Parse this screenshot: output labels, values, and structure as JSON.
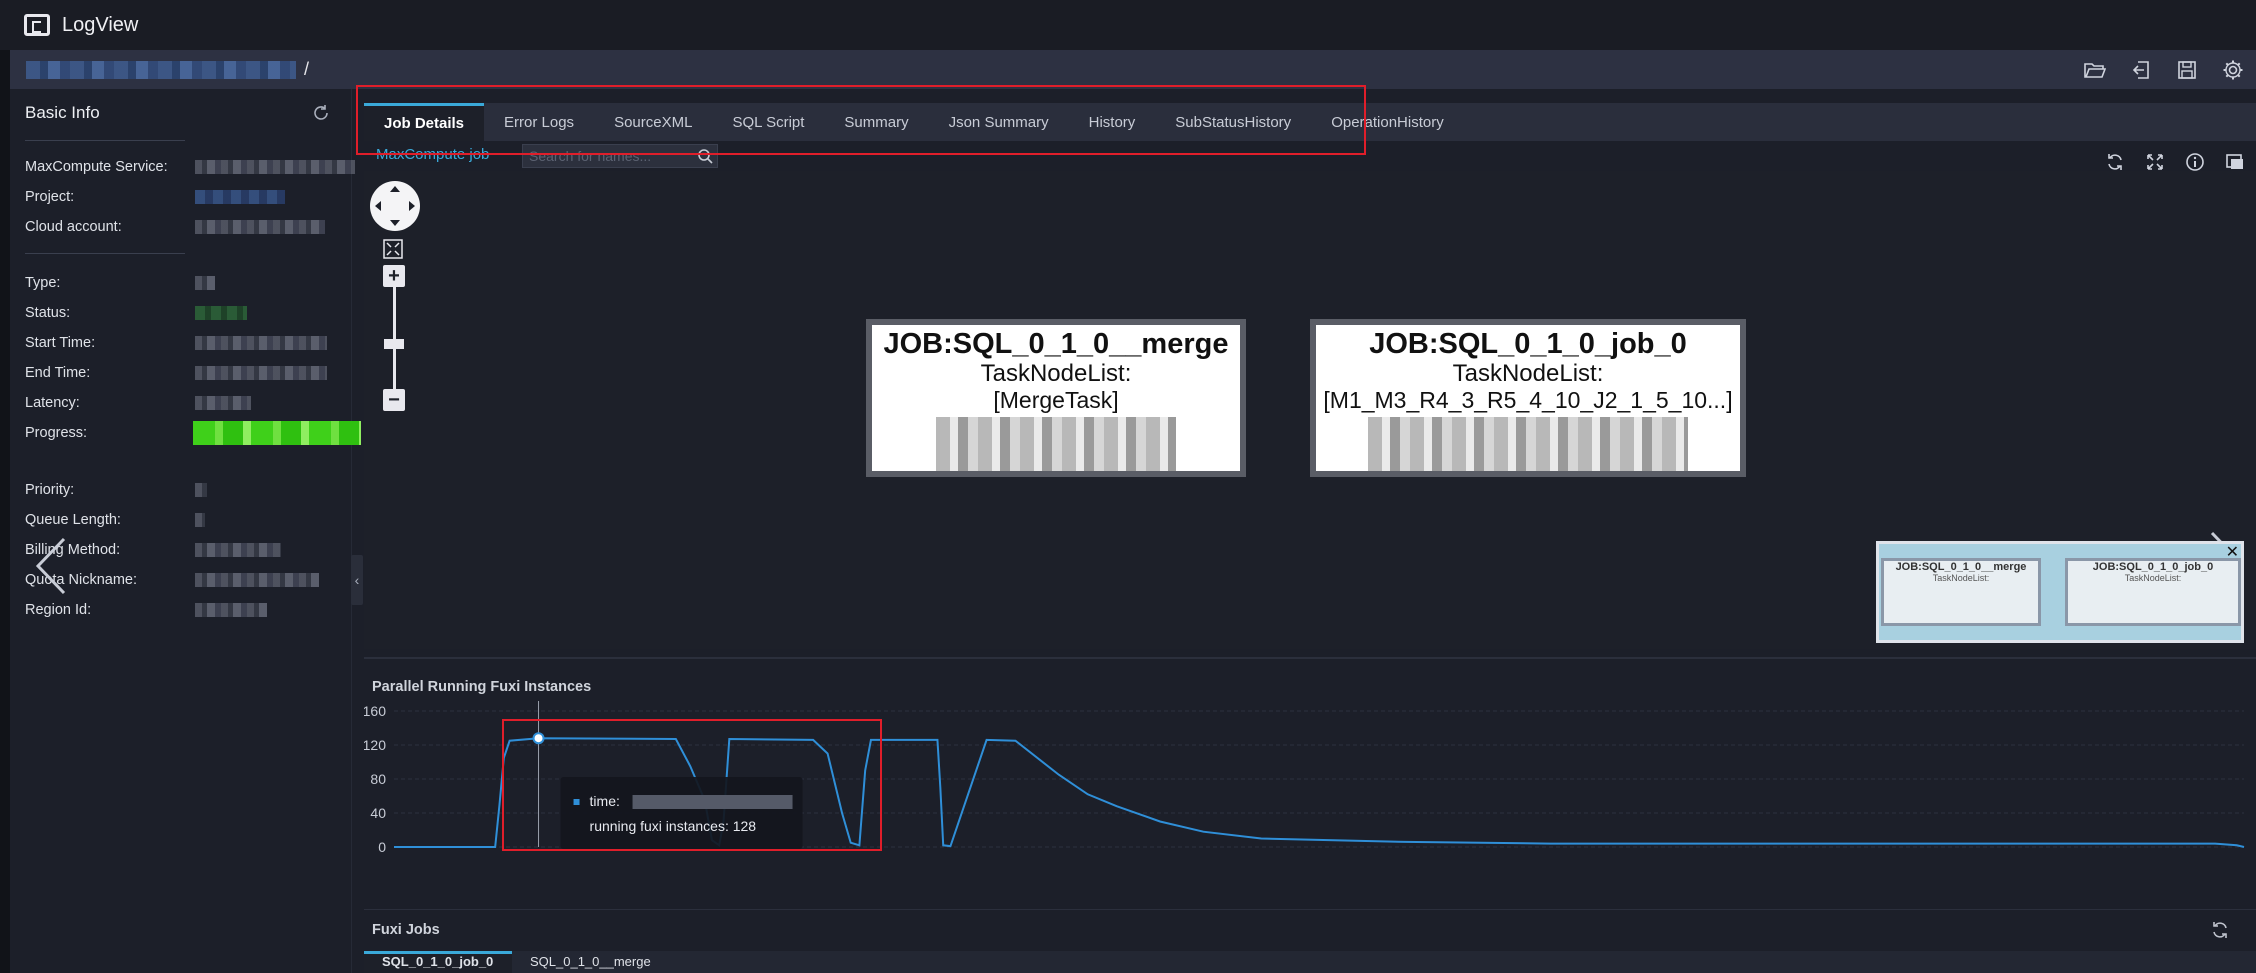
{
  "app": {
    "title": "LogView"
  },
  "path": {
    "separator": "/"
  },
  "toolbar": {
    "icons": [
      "folder-open-icon",
      "exit-icon",
      "save-icon",
      "settings-icon"
    ]
  },
  "basic_info": {
    "header": "Basic Info",
    "fields": [
      {
        "label": "MaxCompute Service:"
      },
      {
        "label": "Project:"
      },
      {
        "label": "Cloud account:"
      },
      {
        "label": "Type:"
      },
      {
        "label": "Status:"
      },
      {
        "label": "Start Time:"
      },
      {
        "label": "End Time:"
      },
      {
        "label": "Latency:"
      },
      {
        "label": "Progress:"
      },
      {
        "label": "Priority:"
      },
      {
        "label": "Queue Length:"
      },
      {
        "label": "Billing Method:"
      },
      {
        "label": "Quota Nickname:"
      },
      {
        "label": "Region Id:"
      }
    ]
  },
  "tabs": [
    {
      "label": "Job Details",
      "active": true
    },
    {
      "label": "Error Logs"
    },
    {
      "label": "SourceXML"
    },
    {
      "label": "SQL Script"
    },
    {
      "label": "Summary"
    },
    {
      "label": "Json Summary"
    },
    {
      "label": "History"
    },
    {
      "label": "SubStatusHistory"
    },
    {
      "label": "OperationHistory"
    }
  ],
  "job_details": {
    "link": "MaxCompute job",
    "search_placeholder": "Search for names..."
  },
  "graph": {
    "nodes": [
      {
        "title": "JOB:SQL_0_1_0__merge",
        "subtitle": "TaskNodeList:",
        "tasks": "[MergeTask]"
      },
      {
        "title": "JOB:SQL_0_1_0_job_0",
        "subtitle": "TaskNodeList:",
        "tasks": "[M1_M3_R4_3_R5_4_10_J2_1_5_10...]"
      }
    ],
    "minimap": {
      "nodes": [
        {
          "title": "JOB:SQL_0_1_0__merge",
          "subtitle": "TaskNodeList:"
        },
        {
          "title": "JOB:SQL_0_1_0_job_0",
          "subtitle": "TaskNodeList:"
        }
      ]
    }
  },
  "chart_section": {
    "title": "Parallel Running Fuxi Instances",
    "tooltip": {
      "time_label": "time:",
      "value_label": "running fuxi instances:",
      "value": "128"
    }
  },
  "chart_data": {
    "type": "line",
    "title": "Parallel Running Fuxi Instances",
    "ylim": [
      0,
      160
    ],
    "yticks": [
      "160",
      "120",
      "80",
      "40",
      "0"
    ],
    "yticks_values": [
      160,
      120,
      80,
      40,
      0
    ],
    "grid": true,
    "series": [
      {
        "color": "#2f8fd8",
        "x": [
          0,
          70,
          73,
          76,
          80,
          100,
          195,
          205,
          215,
          220,
          225,
          228,
          232,
          290,
          300,
          310,
          316,
          322,
          326,
          330,
          376,
          378,
          380,
          385,
          410,
          430,
          460,
          480,
          500,
          530,
          560,
          600,
          700,
          800,
          900,
          1000,
          1100,
          1200,
          1260,
          1275,
          1280
        ],
        "y": [
          0,
          0,
          50,
          105,
          125,
          128,
          127,
          95,
          55,
          8,
          2,
          30,
          127,
          126,
          110,
          40,
          5,
          2,
          90,
          126,
          126,
          70,
          2,
          1,
          126,
          125,
          85,
          62,
          48,
          30,
          18,
          10,
          6,
          4,
          4,
          4,
          4,
          4,
          4,
          2,
          0
        ]
      }
    ],
    "xlim": [
      0,
      1280
    ]
  },
  "fuxi_jobs": {
    "title": "Fuxi Jobs",
    "tabs": [
      {
        "label": "SQL_0_1_0_job_0",
        "active": true
      },
      {
        "label": "SQL_0_1_0__merge"
      }
    ]
  }
}
